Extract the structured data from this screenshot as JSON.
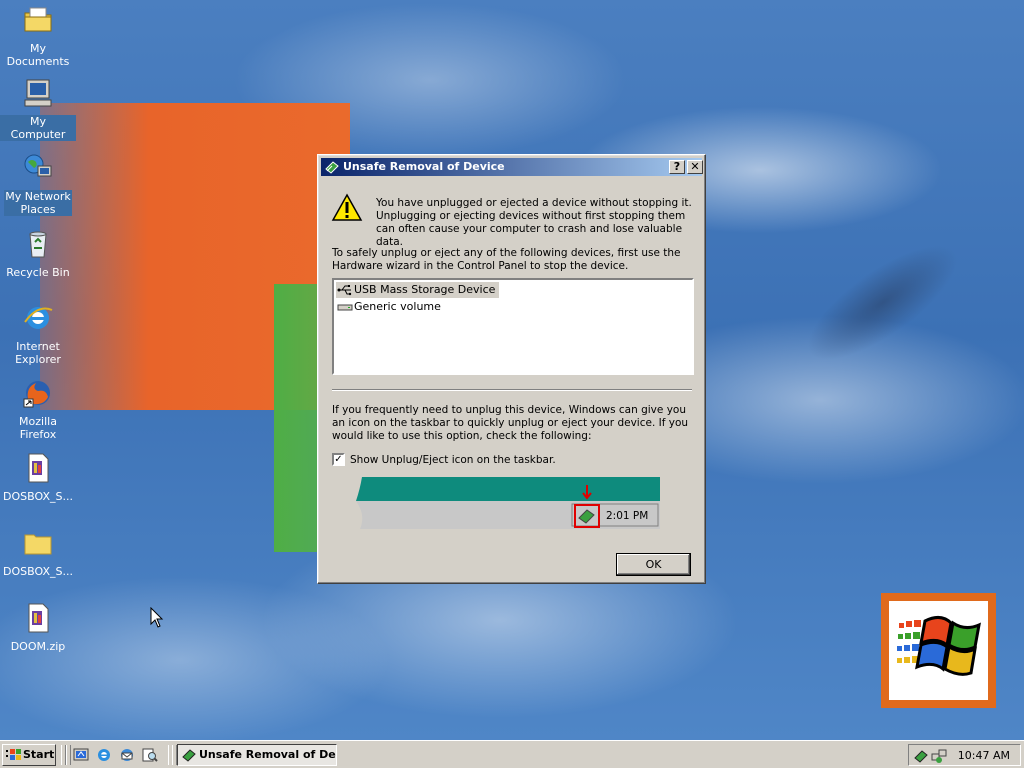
{
  "desktop": {
    "icons": [
      {
        "label": "My Documents",
        "icon": "my-documents-icon"
      },
      {
        "label": "My Computer",
        "icon": "my-computer-icon"
      },
      {
        "label": "My Network Places",
        "icon": "network-places-icon"
      },
      {
        "label": "Recycle Bin",
        "icon": "recycle-bin-icon"
      },
      {
        "label": "Internet Explorer",
        "icon": "internet-explorer-icon"
      },
      {
        "label": "Mozilla Firefox",
        "icon": "firefox-icon"
      },
      {
        "label": "DOSBOX_S...",
        "icon": "zip-file-icon"
      },
      {
        "label": "DOSBOX_S...",
        "icon": "folder-icon"
      },
      {
        "label": "DOOM.zip",
        "icon": "zip-file-icon"
      }
    ]
  },
  "dialog": {
    "title": "Unsafe Removal of Device",
    "help_button": "?",
    "close_button": "✕",
    "warning_text": "You have unplugged or ejected a device without stopping it. Unplugging or ejecting devices without first stopping them can often cause your computer to crash and lose valuable data.",
    "instruction_text": "To safely unplug or eject any of the following devices, first use the Hardware wizard in the Control Panel to stop the device.",
    "devices": [
      {
        "label": "USB Mass Storage Device",
        "icon": "usb-icon"
      },
      {
        "label": "Generic volume",
        "icon": "drive-icon"
      }
    ],
    "option_text": "If you frequently need to unplug this device, Windows can give you an icon on the taskbar to quickly unplug or eject your device. If you would like to use this option, check the following:",
    "checkbox_label": "Show Unplug/Eject icon on the taskbar.",
    "checkbox_checked": true,
    "preview_clock": "2:01 PM",
    "ok_button": "OK"
  },
  "taskbar": {
    "start_label": "Start",
    "task_button": "Unsafe Removal of De...",
    "clock": "10:47 AM"
  },
  "colors": {
    "titlebar_start": "#0a246a",
    "titlebar_end": "#a6caf0",
    "desktop": "#3a6ea5",
    "preview_teal": "#0e8b7d"
  }
}
